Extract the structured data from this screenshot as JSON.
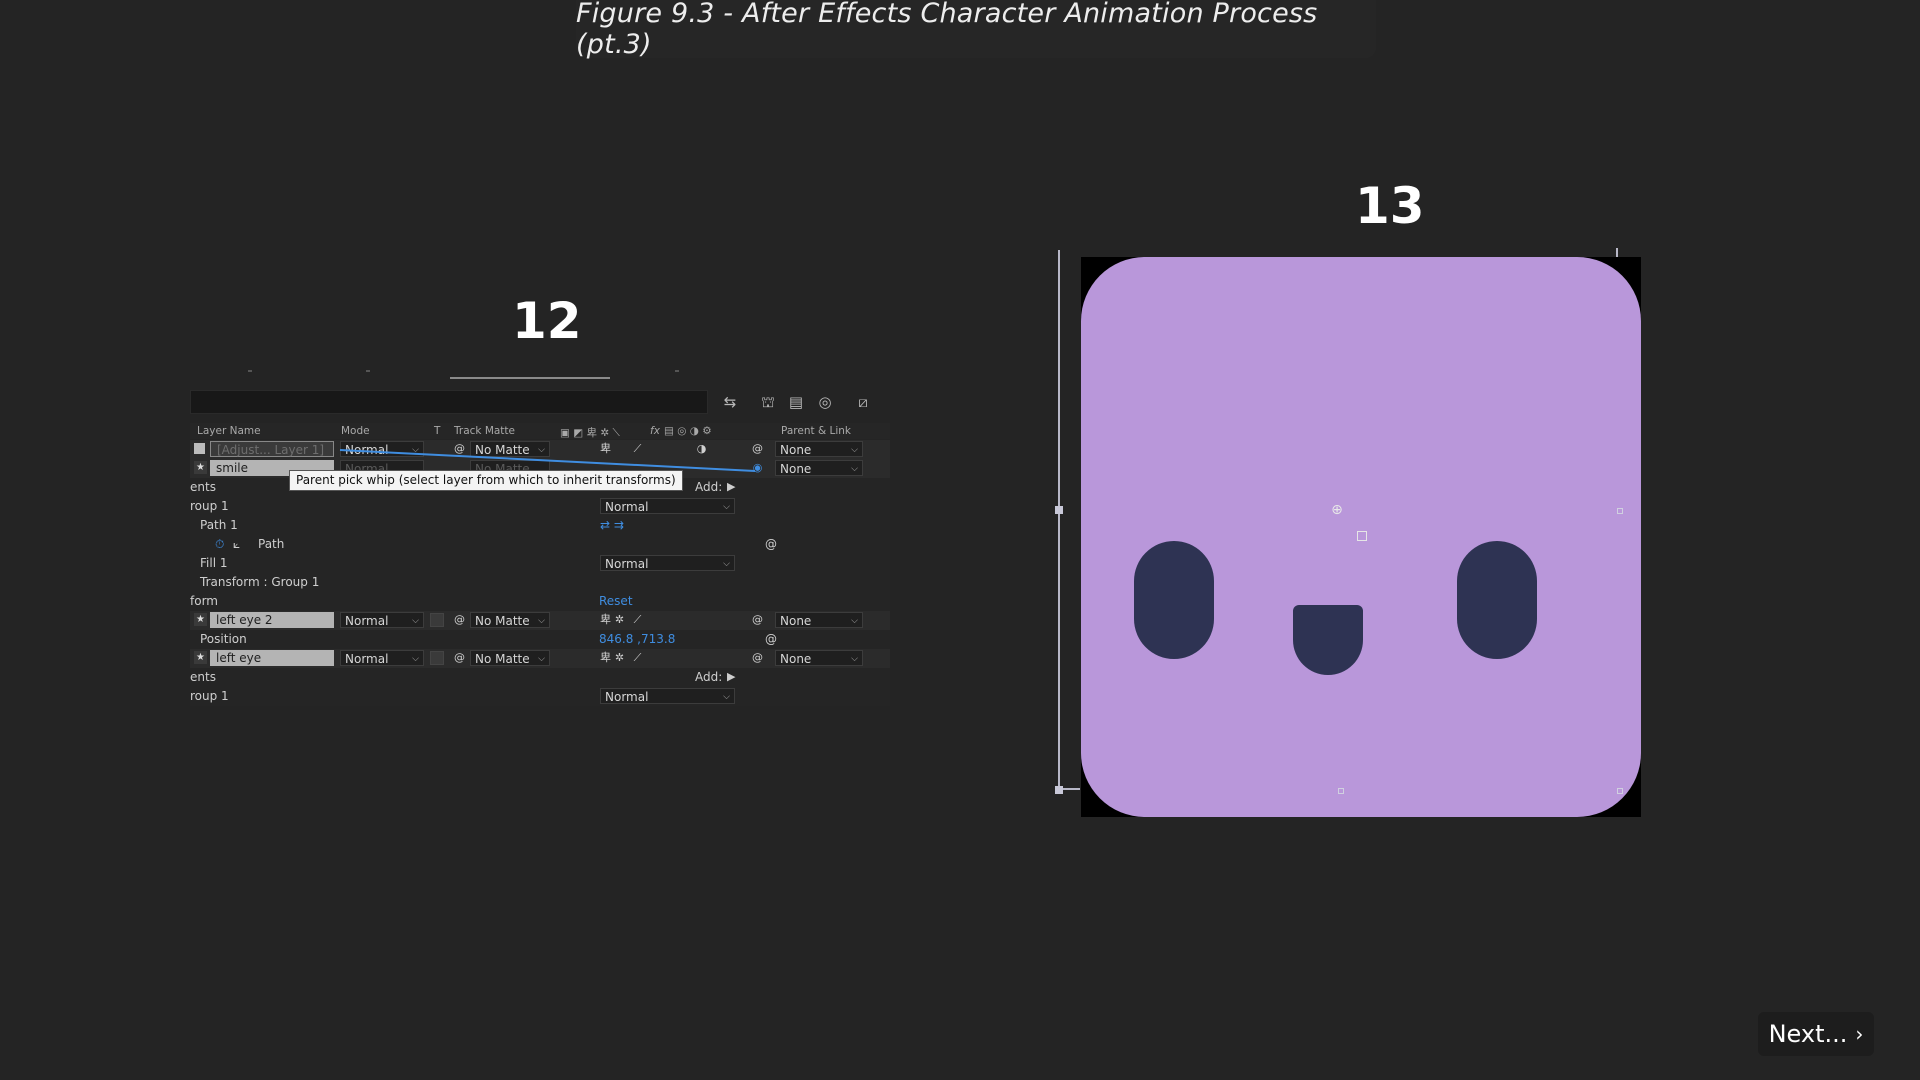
{
  "title": "Figure 9.3 - After Effects Character Animation Process (pt.3)",
  "steps": {
    "left": "12",
    "right": "13"
  },
  "panel": {
    "columns": {
      "layer_name": "Layer Name",
      "mode": "Mode",
      "t": "T",
      "track_matte": "Track Matte",
      "fx": "fx",
      "parent_link": "Parent & Link"
    },
    "rows": {
      "adjust_name": "[Adjust... Layer 1]",
      "adjust_mode": "Normal",
      "adjust_matte": "No Matte",
      "adjust_parent": "None",
      "smile_name": "smile",
      "smile_mode": "Normal",
      "smile_matte": "No Matte",
      "smile_parent": "None",
      "contents": "ents",
      "add_label": "Add:",
      "group1": "roup 1",
      "group1_mode": "Normal",
      "path1": "Path 1",
      "path": "Path",
      "fill1": "Fill 1",
      "fill1_mode": "Normal",
      "transform_group": "Transform : Group 1",
      "transform": "form",
      "reset": "Reset",
      "lefteye2_name": "left eye 2",
      "lefteye2_mode": "Normal",
      "lefteye2_matte": "No Matte",
      "lefteye2_parent": "None",
      "position_label": "Position",
      "position_value": "846.8 ,713.8",
      "lefteye_name": "left eye",
      "lefteye_mode": "Normal",
      "lefteye_matte": "No Matte",
      "lefteye_parent": "None",
      "contents2": "ents",
      "add_label2": "Add:",
      "group1b": "roup 1",
      "group1b_mode": "Normal"
    },
    "tooltip": "Parent pick whip (select layer from which to inherit transforms)"
  },
  "preview": {
    "face_color": "#b997da",
    "feature_color": "#2e3353"
  },
  "next_button": {
    "label": "Next...",
    "icon": "chevron-right-icon"
  }
}
